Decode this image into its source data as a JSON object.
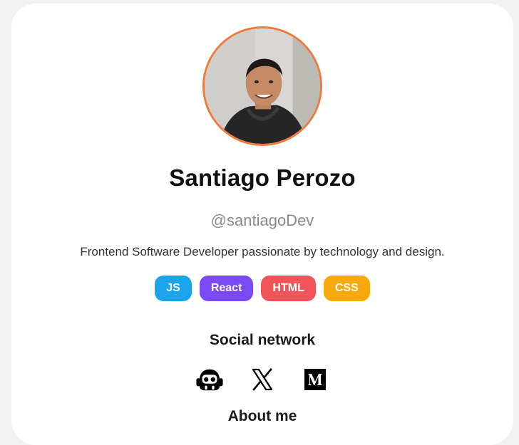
{
  "profile": {
    "name": "Santiago Perozo",
    "handle": "@santiagoDev",
    "bio": "Frontend Software Developer passionate by technology and design."
  },
  "tags": [
    {
      "label": "JS",
      "color": "#1ba3ec"
    },
    {
      "label": "React",
      "color": "#7b49f6"
    },
    {
      "label": "HTML",
      "color": "#f25559"
    },
    {
      "label": "CSS",
      "color": "#f9a90c"
    }
  ],
  "social": {
    "title": "Social network",
    "links": [
      {
        "icon": "github-icon"
      },
      {
        "icon": "x-icon"
      },
      {
        "icon": "medium-icon"
      }
    ]
  },
  "about": {
    "title": "About me"
  },
  "colors": {
    "avatar_border": "#f07a3e",
    "name": "#111111",
    "handle": "#8a8a8a"
  }
}
